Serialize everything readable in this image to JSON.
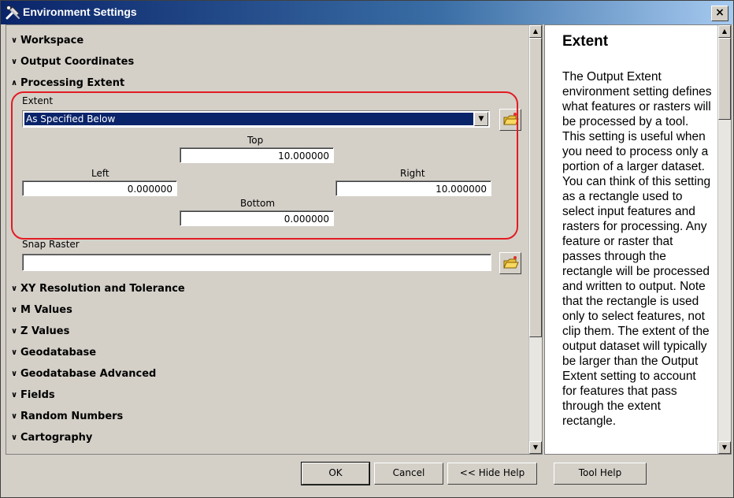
{
  "window": {
    "title": "Environment Settings",
    "close_label": "×"
  },
  "sections_top": [
    {
      "label": "Workspace",
      "state": "collapsed"
    },
    {
      "label": "Output Coordinates",
      "state": "collapsed"
    },
    {
      "label": "Processing Extent",
      "state": "expanded"
    }
  ],
  "processing_extent": {
    "extent_label": "Extent",
    "extent_selected": "As Specified Below",
    "top_label": "Top",
    "top_value": "10.000000",
    "left_label": "Left",
    "left_value": "0.000000",
    "right_label": "Right",
    "right_value": "10.000000",
    "bottom_label": "Bottom",
    "bottom_value": "0.000000",
    "snap_raster_label": "Snap Raster",
    "snap_raster_value": ""
  },
  "sections_bottom": [
    {
      "label": "XY Resolution and Tolerance"
    },
    {
      "label": "M Values"
    },
    {
      "label": "Z Values"
    },
    {
      "label": "Geodatabase"
    },
    {
      "label": "Geodatabase Advanced"
    },
    {
      "label": "Fields"
    },
    {
      "label": "Random Numbers"
    },
    {
      "label": "Cartography"
    }
  ],
  "help": {
    "title": "Extent",
    "body": "The Output Extent environment setting defines what features or rasters will be processed by a tool. This setting is useful when you need to process only a portion of a larger dataset. You can think of this setting as a rectangle used to select input features and rasters for processing. Any feature or raster that passes through the rectangle will be processed and written to output. Note that the rectangle is used only to select features, not clip them. The extent of the output dataset will typically be larger than the Output Extent setting to account for features that pass through the extent rectangle."
  },
  "buttons": {
    "ok": "OK",
    "cancel": "Cancel",
    "hide_help": "<< Hide Help",
    "tool_help": "Tool Help"
  },
  "colors": {
    "selection": "#0a246a",
    "highlight_outline": "#e31b23",
    "dialog_bg": "#d4d0c8"
  }
}
